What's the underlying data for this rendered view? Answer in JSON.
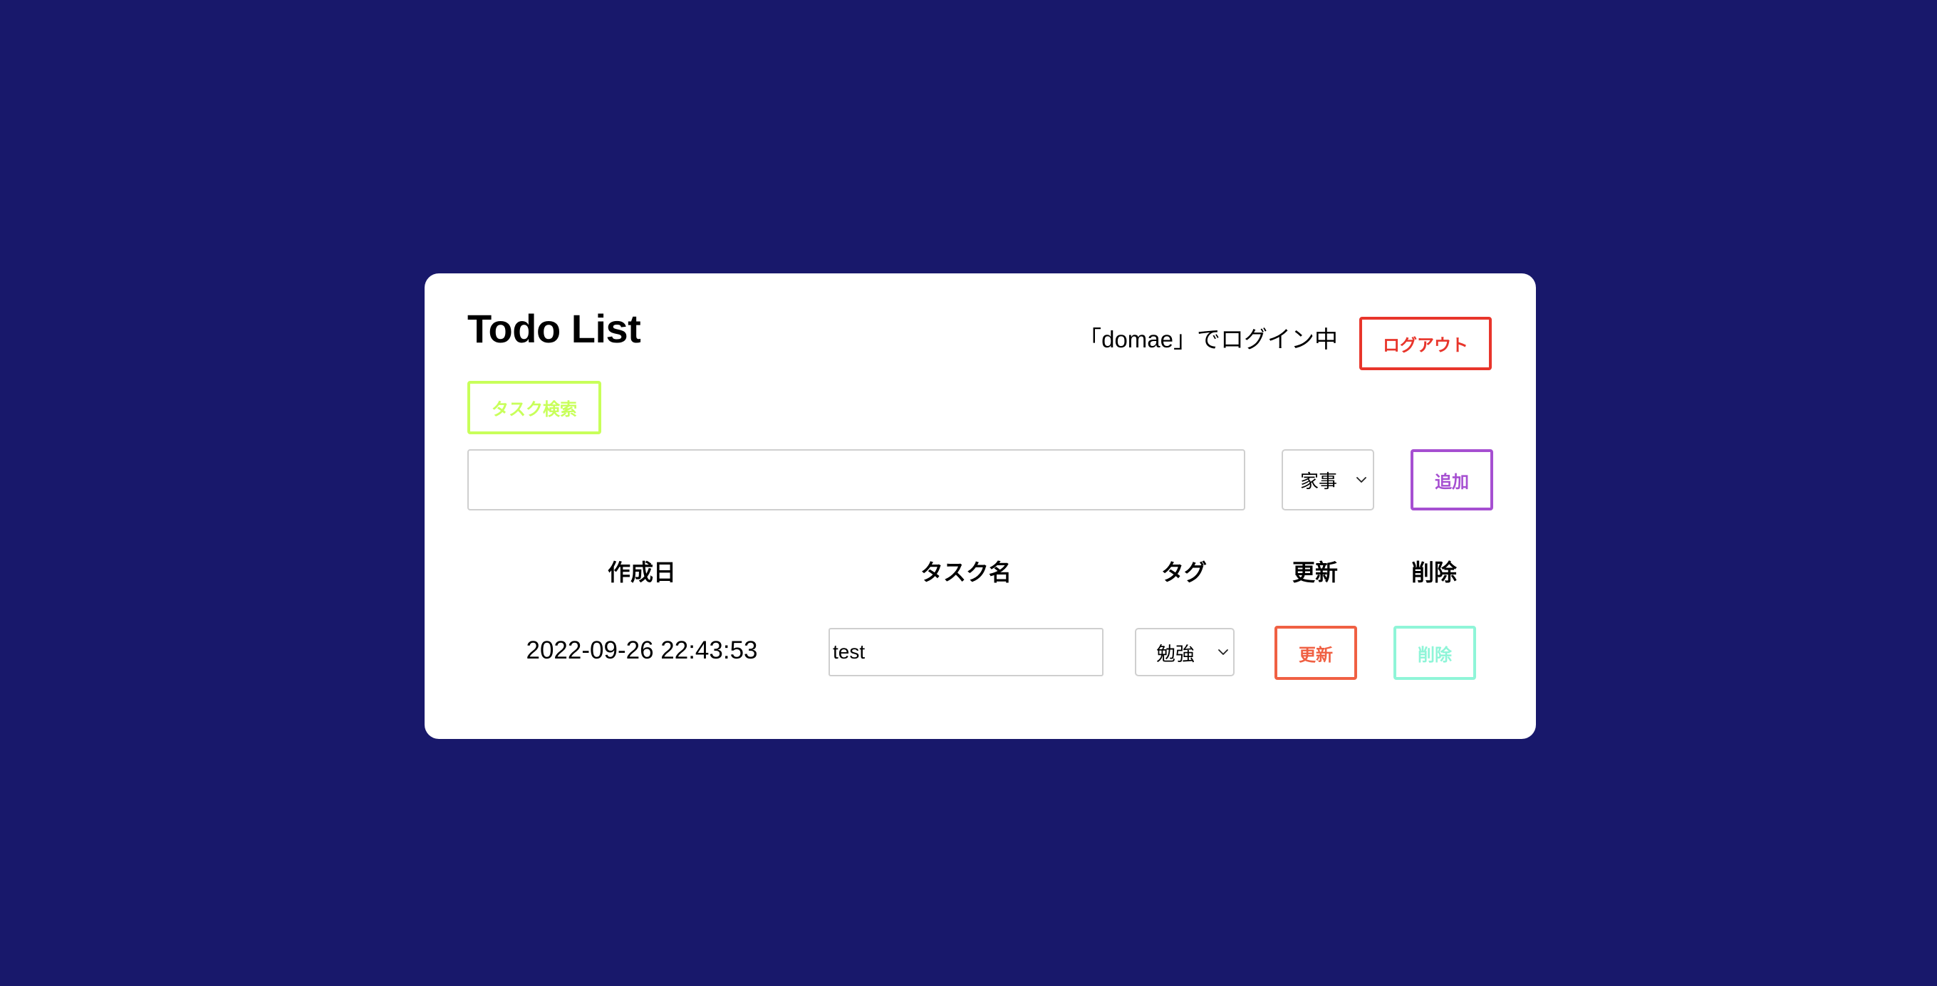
{
  "header": {
    "title": "Todo List",
    "login_status": "「domae」でログイン中",
    "logout_label": "ログアウト"
  },
  "search": {
    "button_label": "タスク検索"
  },
  "new_task": {
    "input_value": "",
    "tag_selected": "家事",
    "add_label": "追加"
  },
  "table": {
    "columns": [
      "作成日",
      "タスク名",
      "タグ",
      "更新",
      "削除"
    ],
    "rows": [
      {
        "created_at": "2022-09-26 22:43:53",
        "task_name": "test",
        "tag": "勉強",
        "update_label": "更新",
        "delete_label": "削除"
      }
    ]
  },
  "colors": {
    "background": "#18186b",
    "logout": "#e8352b",
    "search": "#c8ff5a",
    "add": "#a64fd1",
    "update": "#f06043",
    "delete": "#8ff5d8"
  },
  "icons": {
    "select_chevron": "chevron-down-icon"
  }
}
